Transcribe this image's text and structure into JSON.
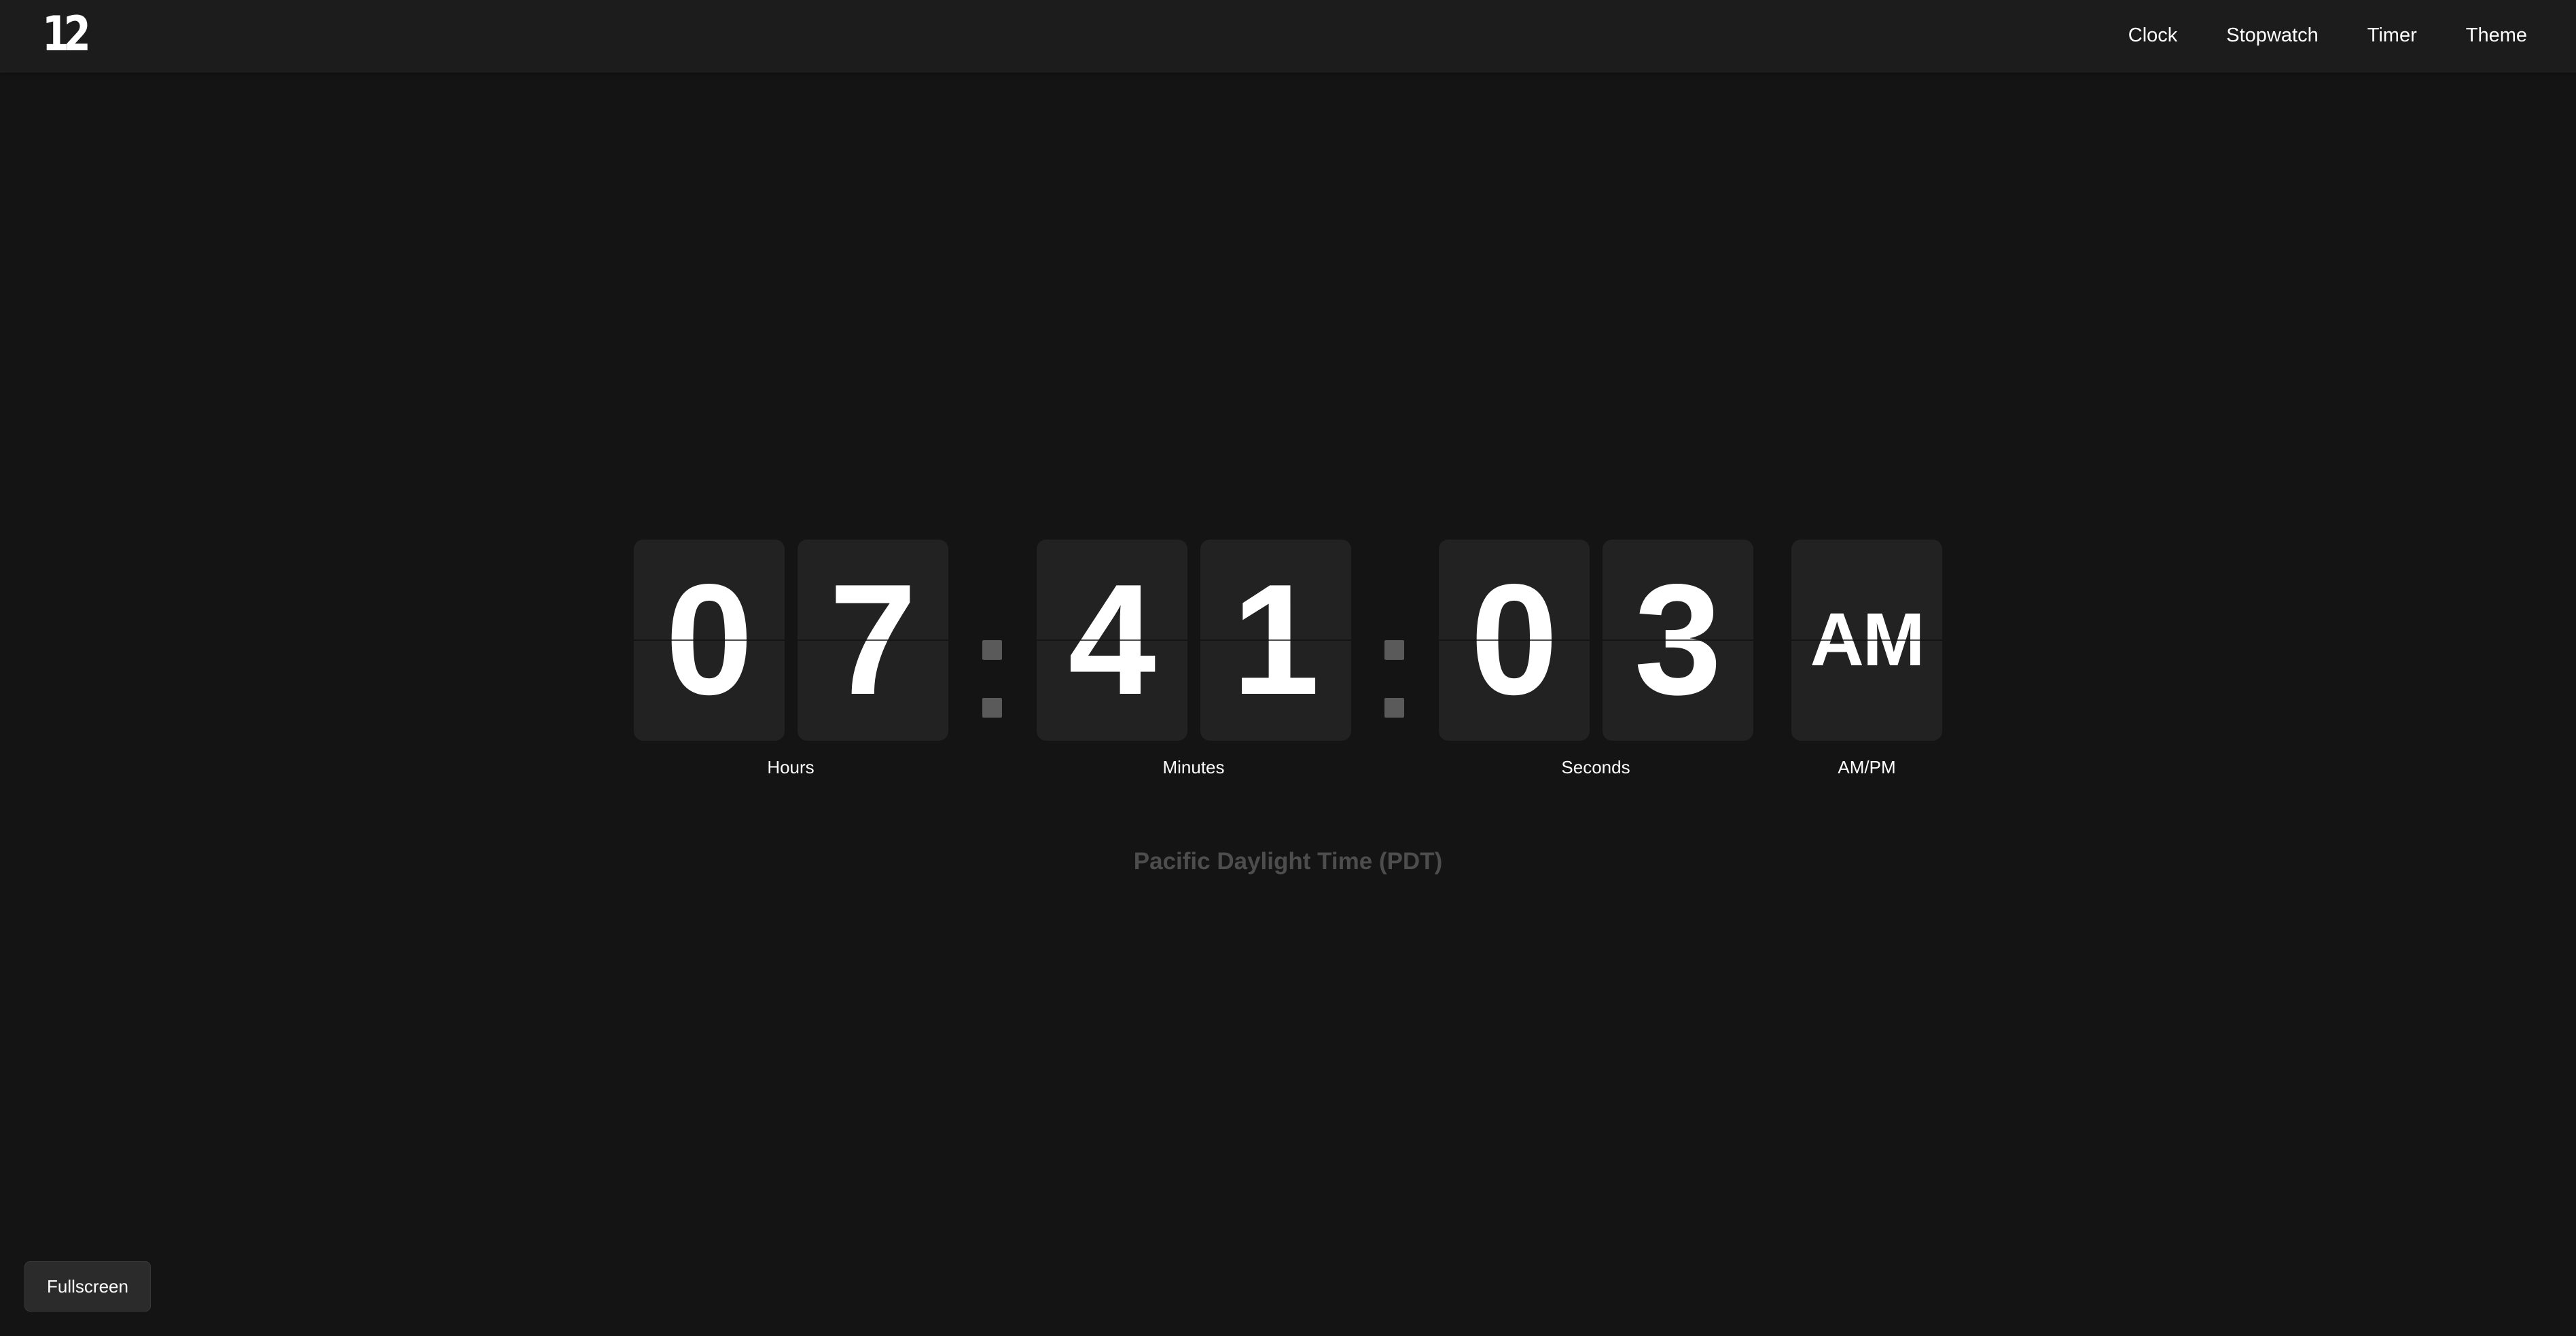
{
  "header": {
    "logo_text": "12",
    "nav": [
      {
        "label": "Clock"
      },
      {
        "label": "Stopwatch"
      },
      {
        "label": "Timer"
      },
      {
        "label": "Theme"
      }
    ]
  },
  "clock": {
    "hours": [
      "0",
      "7"
    ],
    "minutes": [
      "4",
      "1"
    ],
    "seconds": [
      "0",
      "3"
    ],
    "meridiem": "AM",
    "labels": {
      "hours": "Hours",
      "minutes": "Minutes",
      "seconds": "Seconds",
      "meridiem": "AM/PM"
    }
  },
  "timezone": "Pacific Daylight Time (PDT)",
  "controls": {
    "fullscreen_label": "Fullscreen"
  },
  "colors": {
    "background": "#141414",
    "header": "#1c1c1c",
    "card": "#222222",
    "digit": "#ffffff",
    "separator": "#5a5a5a",
    "timezone_text": "#4d4d4d"
  }
}
